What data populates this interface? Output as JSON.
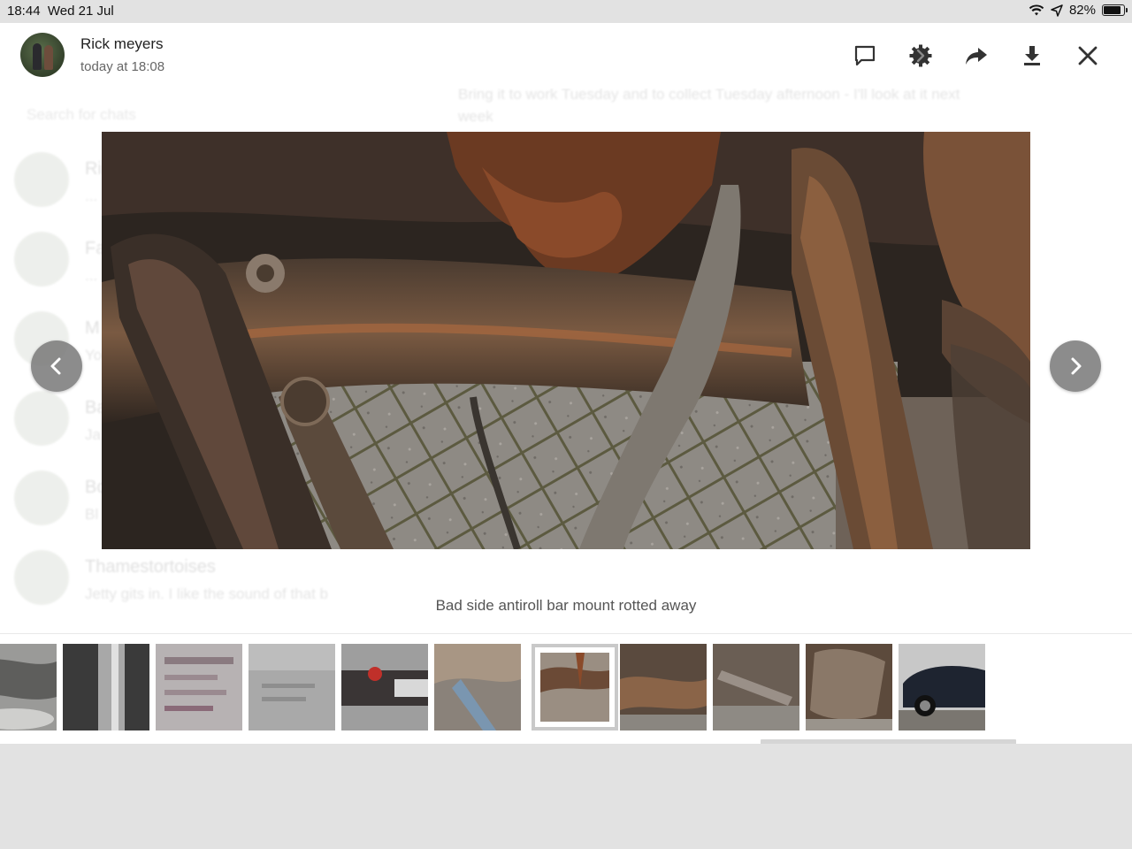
{
  "status_bar": {
    "time": "18:44",
    "date": "Wed 21 Jul",
    "battery": "82%",
    "battery_level": 0.82
  },
  "header": {
    "sender_name": "Rick meyers",
    "sent_time": "today at 18:08",
    "actions": [
      {
        "name": "comment-icon"
      },
      {
        "name": "settings-gear-icon"
      },
      {
        "name": "share-forward-icon"
      },
      {
        "name": "download-icon"
      },
      {
        "name": "close-icon"
      }
    ]
  },
  "photo": {
    "caption": "Bad side antiroll bar mount rotted away"
  },
  "background_chat": {
    "search_placeholder": "Search for chats",
    "message_text": "Bring it to work Tuesday and to collect Tuesday afternoon - I'll look at it next week",
    "contacts": [
      {
        "name": "Ri",
        "snippet": "..."
      },
      {
        "name": "Fa",
        "snippet": "..."
      },
      {
        "name": "M",
        "snippet": "Yo"
      },
      {
        "name": "Ba",
        "snippet": "Ja"
      },
      {
        "name": "Bo",
        "snippet": "Bl"
      },
      {
        "name": "Thamestortoises",
        "snippet": "Jetty gits in. I like the sound of that b"
      }
    ]
  },
  "thumbnails": {
    "count": 11,
    "selected_index": 6
  },
  "colors": {
    "nav_button": "#787878",
    "background": "#e2e2e2",
    "selected_thumb_border": "#c9c9c9"
  }
}
